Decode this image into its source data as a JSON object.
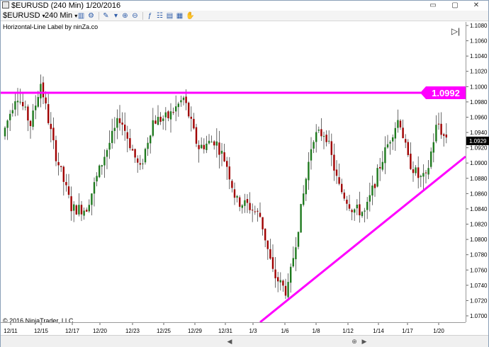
{
  "window": {
    "title": "$EURUSD (240 Min)  1/20/2016"
  },
  "toolbar": {
    "instrument": "$EURUSD",
    "interval": "240 Min"
  },
  "chart": {
    "indicator_label": "Horizontal-Line Label by ninZa.co",
    "copyright": "© 2016 NinjaTrader, LLC",
    "price_ticks": [
      "1.1080",
      "1.1060",
      "1.1040",
      "1.1020",
      "1.1000",
      "1.0980",
      "1.0960",
      "1.0940",
      "1.0920",
      "1.0900",
      "1.0880",
      "1.0860",
      "1.0840",
      "1.0820",
      "1.0800",
      "1.0780",
      "1.0760",
      "1.0740",
      "1.0720",
      "1.0700"
    ],
    "date_ticks": [
      "12/11",
      "12/15",
      "12/17",
      "12/20",
      "12/23",
      "12/25",
      "12/29",
      "12/31",
      "1/3",
      "1/6",
      "1/8",
      "1/12",
      "1/14",
      "1/17",
      "1/20"
    ],
    "horizontal_line_label": "1.0992",
    "current_price_label": "1.0929",
    "colors": {
      "line": "#ff00ff",
      "up": "#1f7a1f",
      "down": "#a00000"
    }
  }
}
